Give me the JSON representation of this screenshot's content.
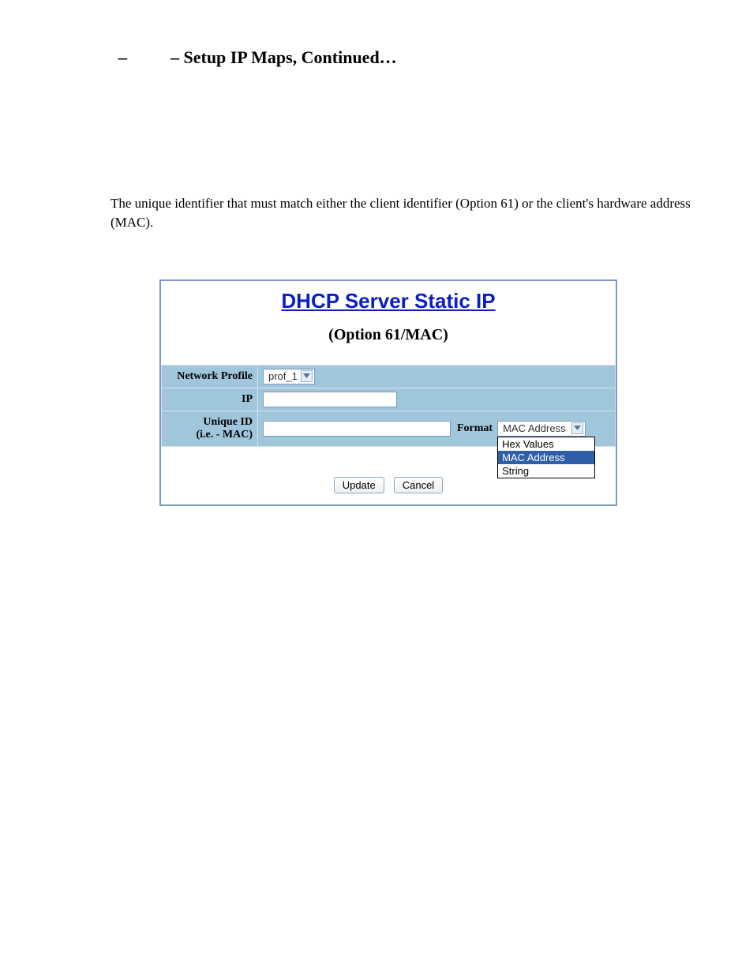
{
  "page": {
    "title_dash1": "–",
    "title_dash2": "–",
    "title_text": "Setup IP Maps, Continued…",
    "intro": "The unique identifier that must match either the client identifier (Option 61) or the client's hardware address (MAC)."
  },
  "panel": {
    "title": "DHCP Server Static IP",
    "subtitle": "(Option 61/MAC)"
  },
  "form": {
    "network_profile": {
      "label": "Network Profile",
      "value": "prof_1"
    },
    "ip": {
      "label": "IP",
      "value": ""
    },
    "unique_id": {
      "label_line1": "Unique ID",
      "label_line2": "(i.e. - MAC)",
      "value": "",
      "format_label": "Format",
      "format_value": "MAC Address",
      "format_options": [
        "Hex Values",
        "MAC Address",
        "String"
      ]
    },
    "buttons": {
      "update": "Update",
      "cancel": "Cancel"
    }
  }
}
